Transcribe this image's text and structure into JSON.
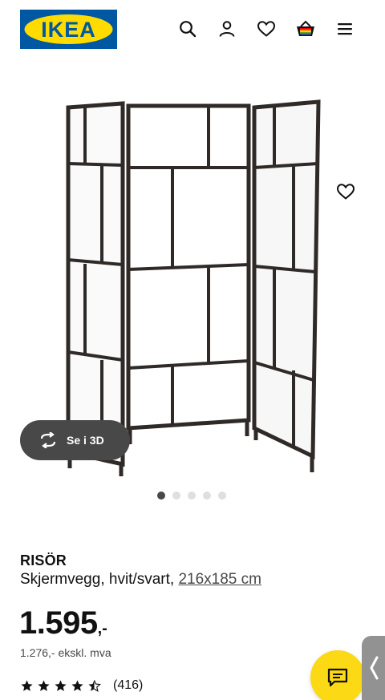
{
  "header": {
    "logo_text": "IKEA",
    "icons": [
      "search-icon",
      "user-icon",
      "heart-icon",
      "basket-icon",
      "menu-icon"
    ]
  },
  "gallery": {
    "view_3d_label": "Se i 3D",
    "slide_count": 5,
    "active_slide": 1
  },
  "product": {
    "name": "RISÖR",
    "description": "Skjermvegg, hvit/svart,",
    "measurement": "216x185 cm",
    "price": "1.595",
    "price_suffix": ",-",
    "price_ex_vat": "1.276,- ekskl. mva",
    "rating_stars": 4.5,
    "review_count": "(416)"
  },
  "colors": {
    "ikea_blue": "#0058a3",
    "ikea_yellow": "#ffdb00",
    "chat_yellow": "#fbd914",
    "dark_pill": "#484848"
  }
}
